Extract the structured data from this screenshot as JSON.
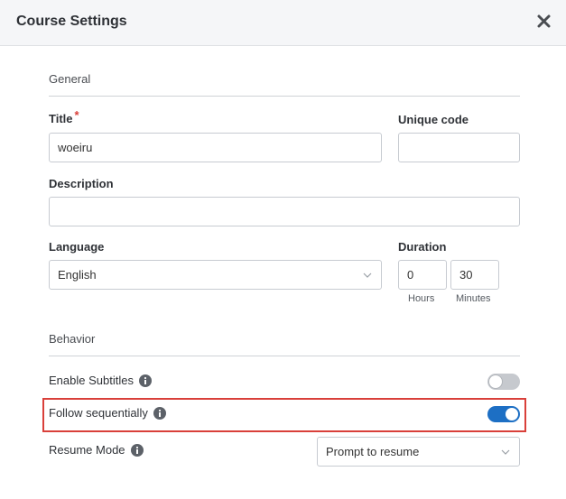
{
  "header": {
    "title": "Course Settings"
  },
  "general": {
    "section_label": "General",
    "title_label": "Title",
    "title_required_mark": "*",
    "title_value": "woeiru",
    "unique_code_label": "Unique code",
    "unique_code_value": "",
    "description_label": "Description",
    "description_value": "",
    "language_label": "Language",
    "language_value": "English",
    "duration_label": "Duration",
    "duration_hours": "0",
    "duration_minutes": "30",
    "hours_label": "Hours",
    "minutes_label": "Minutes"
  },
  "behavior": {
    "section_label": "Behavior",
    "enable_subtitles_label": "Enable Subtitles",
    "enable_subtitles_on": false,
    "follow_sequentially_label": "Follow sequentially",
    "follow_sequentially_on": true,
    "resume_mode_label": "Resume Mode",
    "resume_mode_value": "Prompt to resume"
  },
  "colors": {
    "accent": "#1d6fc4",
    "highlight": "#d9403a",
    "header_bg": "#f5f6f8"
  },
  "icons": {
    "close": "close-icon",
    "info": "info-icon",
    "chevron": "chevron-down-icon"
  }
}
